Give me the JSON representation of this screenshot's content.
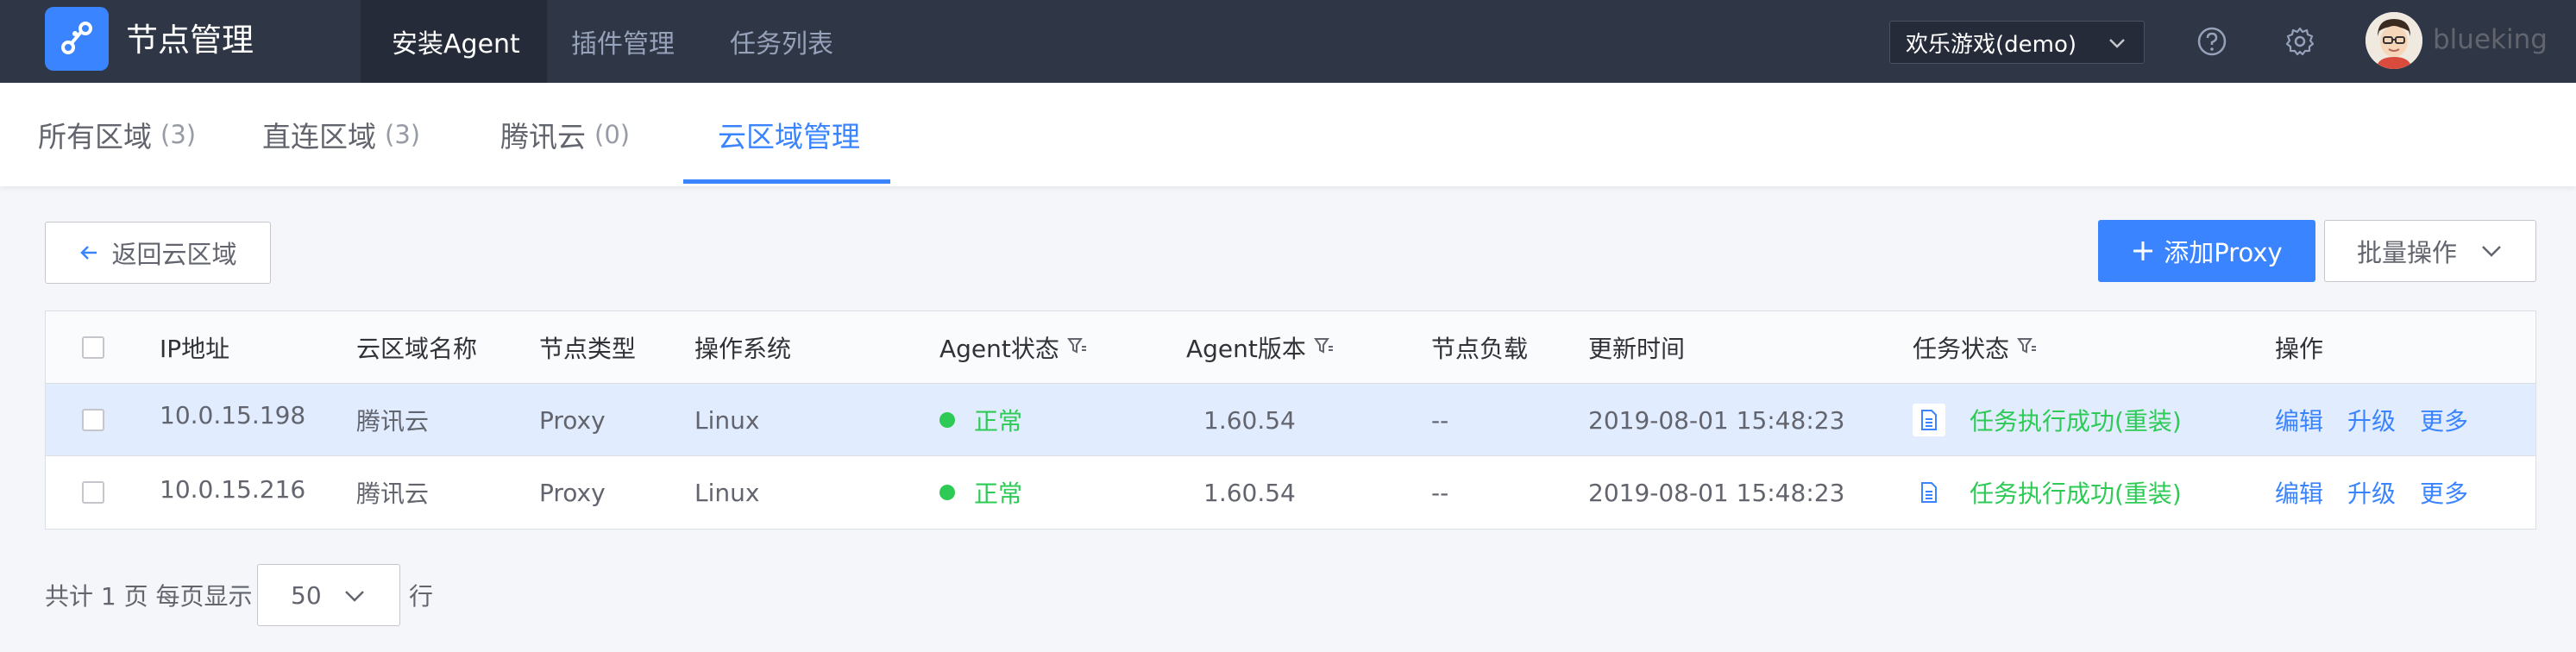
{
  "app": {
    "title": "节点管理",
    "logo_icon": "nodes-logo-icon"
  },
  "nav": {
    "items": [
      {
        "label": "安装Agent",
        "active": true
      },
      {
        "label": "插件管理",
        "active": false
      },
      {
        "label": "任务列表",
        "active": false
      }
    ]
  },
  "header": {
    "business_select": "欢乐游戏(demo)",
    "help_icon": "help-icon",
    "settings_icon": "gear-icon",
    "username": "blueking"
  },
  "tabs": [
    {
      "label": "所有区域",
      "count": "(3)"
    },
    {
      "label": "直连区域",
      "count": "(3)"
    },
    {
      "label": "腾讯云",
      "count": "(0)"
    },
    {
      "label": "云区域管理",
      "count": ""
    }
  ],
  "toolbar": {
    "back_label": "返回云区域",
    "add_label": "添加Proxy",
    "batch_label": "批量操作"
  },
  "table": {
    "columns": [
      "IP地址",
      "云区域名称",
      "节点类型",
      "操作系统",
      "Agent状态",
      "Agent版本",
      "节点负载",
      "更新时间",
      "任务状态",
      "操作"
    ],
    "rows": [
      {
        "ip": "10.0.15.198",
        "cloud": "腾讯云",
        "node_type": "Proxy",
        "os": "Linux",
        "agent_status": "正常",
        "agent_version": "1.60.54",
        "load": "--",
        "updated": "2019-08-01 15:48:23",
        "task_status": "任务执行成功(重装)",
        "actions": [
          "编辑",
          "升级",
          "更多"
        ]
      },
      {
        "ip": "10.0.15.216",
        "cloud": "腾讯云",
        "node_type": "Proxy",
        "os": "Linux",
        "agent_status": "正常",
        "agent_version": "1.60.54",
        "load": "--",
        "updated": "2019-08-01 15:48:23",
        "task_status": "任务执行成功(重装)",
        "actions": [
          "编辑",
          "升级",
          "更多"
        ]
      }
    ]
  },
  "pagination": {
    "prefix": "共计 1 页 每页显示",
    "page_size": "50",
    "suffix": "行"
  },
  "colors": {
    "nav_bg": "#2f3646",
    "accent": "#3a84ff",
    "success": "#2dcb56",
    "selected_row": "#e1ecff"
  }
}
